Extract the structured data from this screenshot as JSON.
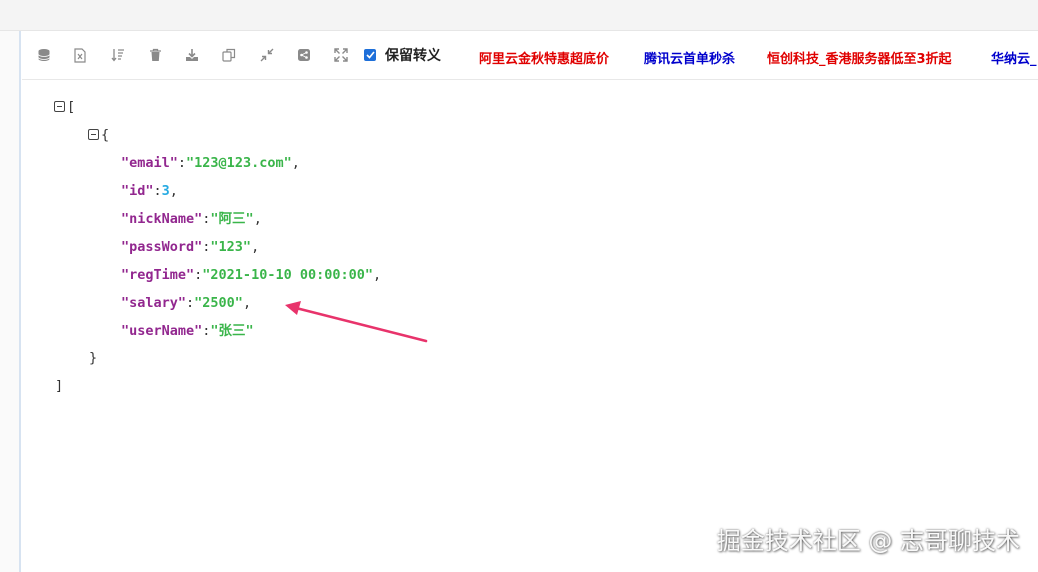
{
  "toolbar": {
    "icons": [
      "database-icon",
      "excel-icon",
      "sort-icon",
      "trash-icon",
      "download-icon",
      "copy-icon",
      "compress-icon",
      "share-icon",
      "expand-icon"
    ],
    "checkbox_checked": true,
    "checkbox_label": "保留转义",
    "ads": [
      {
        "label": "阿里云金秋特惠超底价",
        "color": "#e00000"
      },
      {
        "label": "腾讯云首单秒杀",
        "color": "#0000cc"
      },
      {
        "label": "恒创科技_香港服务器低至3折起",
        "color": "#e00000"
      },
      {
        "label": "华纳云_",
        "color": "#0000cc"
      }
    ]
  },
  "json_view": {
    "open_bracket": "[",
    "close_bracket": "]",
    "object_open": "{",
    "object_close": "}",
    "fields": [
      {
        "key": "\"email\"",
        "value": "\"123@123.com\"",
        "type": "string",
        "trail": ","
      },
      {
        "key": "\"id\"",
        "value": "3",
        "type": "number",
        "trail": ","
      },
      {
        "key": "\"nickName\"",
        "value": "\"阿三\"",
        "type": "string",
        "trail": ","
      },
      {
        "key": "\"passWord\"",
        "value": "\"123\"",
        "type": "string",
        "trail": ","
      },
      {
        "key": "\"regTime\"",
        "value": "\"2021-10-10 00:00:00\"",
        "type": "string",
        "trail": ","
      },
      {
        "key": "\"salary\"",
        "value": "\"2500\"",
        "type": "string",
        "trail": ","
      },
      {
        "key": "\"userName\"",
        "value": "\"张三\"",
        "type": "string",
        "trail": ""
      }
    ]
  },
  "colors": {
    "key": "#92278f",
    "string": "#3ab54a",
    "number": "#25aae2",
    "arrow": "#e8336b"
  },
  "watermark": "掘金技术社区 @ 志哥聊技术"
}
